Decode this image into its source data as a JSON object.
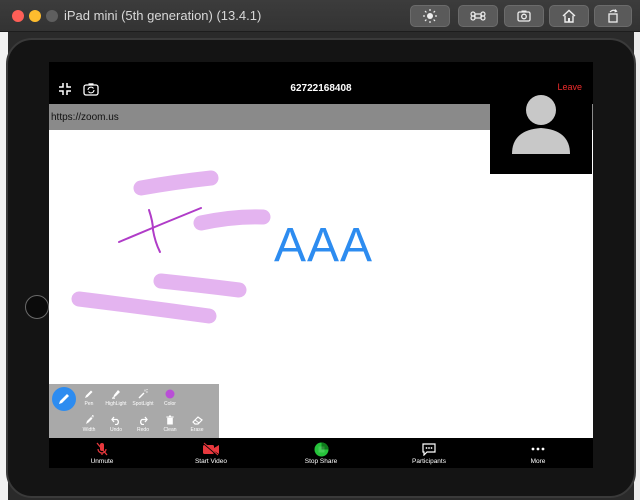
{
  "window": {
    "title": "iPad mini (5th generation) (13.4.1)",
    "toolbar_icons": [
      "brightness-icon",
      "command-icon",
      "screenshot-icon",
      "home-icon",
      "rotate-icon"
    ]
  },
  "meeting": {
    "id": "62722168408",
    "url": "https://zoom.us",
    "leave_label": "Leave"
  },
  "canvas": {
    "text": "AAA",
    "colors": {
      "highlight": "#e4b4f0",
      "pen": "#b03cc8",
      "text": "#2d8cf0"
    }
  },
  "annotate_tools": {
    "row1": [
      {
        "label": "Pen",
        "icon": "pen-icon"
      },
      {
        "label": "HighLight",
        "icon": "highlighter-icon"
      },
      {
        "label": "SpotLight",
        "icon": "spotlight-icon"
      },
      {
        "label": "Color",
        "icon": "color-dot-icon"
      }
    ],
    "row2": [
      {
        "label": "Width",
        "icon": "width-icon"
      },
      {
        "label": "Undo",
        "icon": "undo-icon"
      },
      {
        "label": "Redo",
        "icon": "redo-icon"
      },
      {
        "label": "Clean",
        "icon": "trash-icon"
      },
      {
        "label": "Erase",
        "icon": "eraser-icon"
      }
    ],
    "selected_color": "#b94fd6"
  },
  "bottom_bar": {
    "unmute": "Unmute",
    "start_video": "Start Video",
    "stop_share": "Stop Share",
    "participants": "Participants",
    "more": "More"
  }
}
